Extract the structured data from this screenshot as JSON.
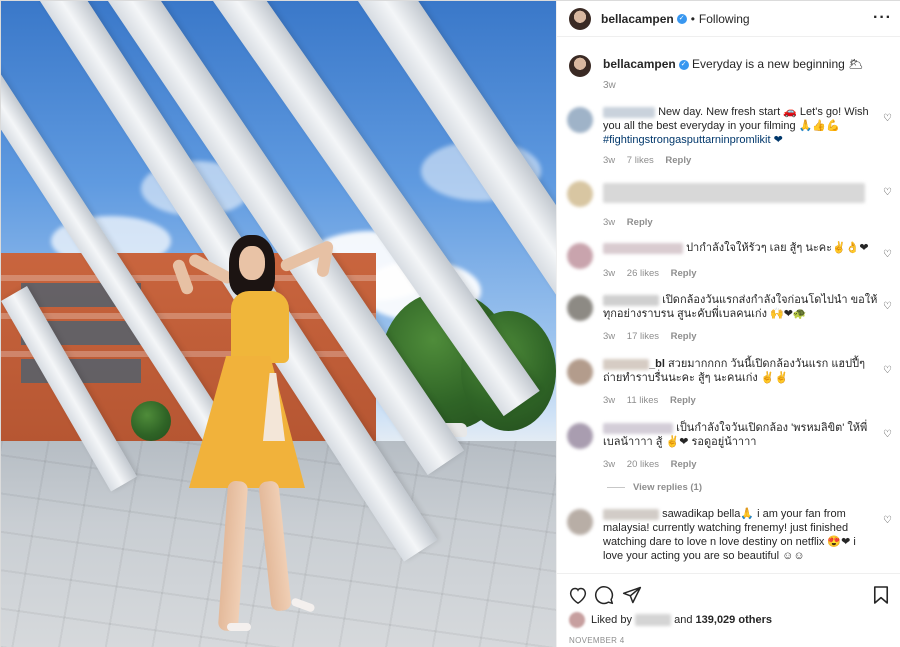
{
  "post": {
    "username": "bellacampen",
    "follow_status": "Following",
    "more_icon": "more-options-icon"
  },
  "caption": {
    "username": "bellacampen",
    "text": "Everyday is a new beginning 🌥",
    "time": "3w"
  },
  "comments": [
    {
      "text": "New day. New fresh start 🚗 Let's go! Wish you all the best everyday in your filming 🙏👍💪",
      "hashtag": "#fightingstrongasputtarninpromlikit ❤",
      "time": "3w",
      "likes": "7 likes",
      "reply": "Reply",
      "avatar_color": "#9fb3c8"
    },
    {
      "text": "",
      "time": "3w",
      "reply": "Reply",
      "avatar_color": "#d8c6a2"
    },
    {
      "text": "ปากำลังใจให้รัวๆ เลย สู้ๆ นะคะ✌👌❤",
      "time": "3w",
      "likes": "26 likes",
      "reply": "Reply",
      "avatar_color": "#c9a4ad"
    },
    {
      "text": "เปิดกล้องวันแรกส่งกำลังใจก่อนโดไปนำ ขอให้ทุกอย่างราบรน สูนะคับพี่เบลคนเก่ง 🙌❤🐢",
      "time": "3w",
      "likes": "17 likes",
      "reply": "Reply",
      "avatar_color": "#8d8a84"
    },
    {
      "name_suffix": "_bl",
      "text": "สวยมากกกก วันนี้เปิดกล้องวันแรก แฮปปี้ๆ ถ่ายทำราบรื่นนะคะ สู้ๆ นะคนเก่ง ✌✌",
      "time": "3w",
      "likes": "11 likes",
      "reply": "Reply",
      "avatar_color": "#b39c8c"
    },
    {
      "text": "เป็นกำลังใจวันเปิดกล้อง 'พรหมลิขิต' ให้พี่เบลน้าาาา สู้ ✌❤ รอดูอยู่น้าาาา",
      "time": "3w",
      "likes": "20 likes",
      "reply": "Reply",
      "view_replies": "View replies (1)",
      "avatar_color": "#a99db0"
    },
    {
      "text": "sawadikap bella🙏 i am your fan from malaysia! currently watching frenemy! just finished watching dare to love n love destiny on netflix 😍❤ i love your acting you are so beautiful ☺☺",
      "avatar_color": "#b8aea6"
    }
  ],
  "actions": {
    "like_icon": "heart-icon",
    "comment_icon": "comment-icon",
    "share_icon": "share-icon",
    "save_icon": "bookmark-icon"
  },
  "likes": {
    "prefix": "Liked by",
    "connector": "and",
    "count": "139,029 others"
  },
  "date": "NOVEMBER 4",
  "colors": {
    "link": "#00376b",
    "muted": "#8e8e8e",
    "verified": "#3897f0",
    "dress": "#f1b23b"
  }
}
